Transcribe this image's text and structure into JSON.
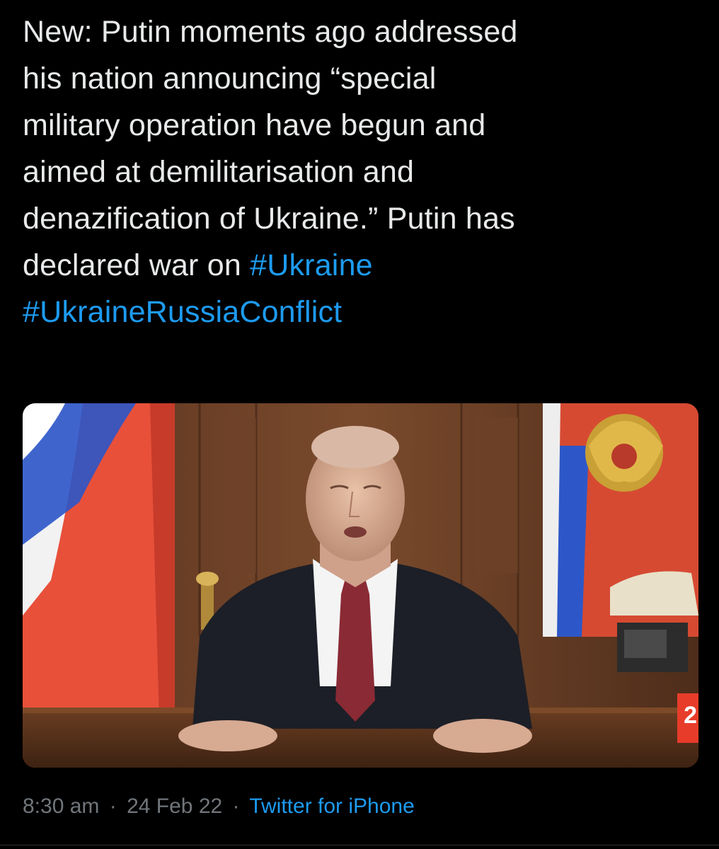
{
  "tweet": {
    "text_lines": [
      "New: Putin moments ago addressed",
      "his nation announcing “special",
      "military operation have begun and",
      "aimed at demilitarisation and",
      "denazification of Ukraine.” Putin has",
      "declared war on "
    ],
    "hashtags": [
      "#Ukraine",
      "#UkraineRussiaConflict"
    ],
    "media": {
      "corner_badge": "2"
    },
    "meta": {
      "time": "8:30 am",
      "separator": "·",
      "date": "24 Feb 22",
      "source": "Twitter for iPhone"
    }
  },
  "colors": {
    "background": "#000000",
    "text": "#e7e9ea",
    "link": "#1d9bf0",
    "muted": "#71767b"
  }
}
